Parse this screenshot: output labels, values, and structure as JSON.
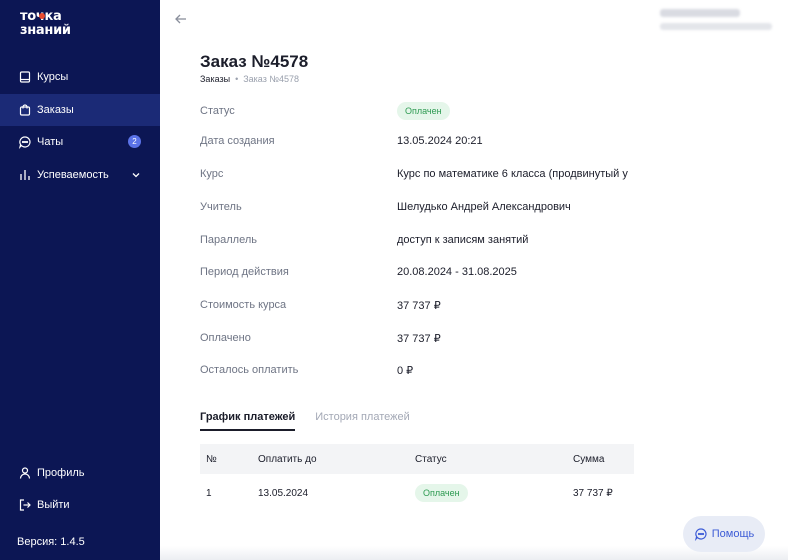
{
  "sidebar": {
    "logo_line1": "точка",
    "logo_line2": "знаний",
    "items": [
      {
        "label": "Курсы"
      },
      {
        "label": "Заказы"
      },
      {
        "label": "Чаты",
        "badge": "2"
      },
      {
        "label": "Успеваемость"
      }
    ],
    "bottom_items": [
      {
        "label": "Профиль"
      },
      {
        "label": "Выйти"
      }
    ],
    "version": "Версия: 1.4.5"
  },
  "header": {
    "title": "Заказ №4578",
    "breadcrumb_root": "Заказы",
    "breadcrumb_sep": "•",
    "breadcrumb_current": "Заказ №4578"
  },
  "details": [
    {
      "label": "Статус",
      "value": "Оплачен"
    },
    {
      "label": "Дата создания",
      "value": "13.05.2024 20:21"
    },
    {
      "label": "Курс",
      "value": "Курс по математике 6 класса (продвинутый у"
    },
    {
      "label": "Учитель",
      "value": "Шелудько Андрей Александрович"
    },
    {
      "label": "Параллель",
      "value": "доступ к записям занятий"
    },
    {
      "label": "Период действия",
      "value": "20.08.2024 - 31.08.2025"
    },
    {
      "label": "Стоимость курса",
      "value": "37 737 ₽"
    },
    {
      "label": "Оплачено",
      "value": "37 737 ₽"
    },
    {
      "label": "Осталось оплатить",
      "value": "0 ₽"
    }
  ],
  "tabs": [
    {
      "label": "График платежей",
      "active": true
    },
    {
      "label": "История платежей",
      "active": false
    }
  ],
  "table": {
    "columns": [
      "№",
      "Оплатить до",
      "Статус",
      "Сумма"
    ],
    "rows": [
      {
        "num": "1",
        "due": "13.05.2024",
        "status": "Оплачен",
        "amount": "37 737 ₽"
      }
    ]
  },
  "help_label": "Помощь",
  "colors": {
    "sidebar_bg": "#0c1654",
    "sidebar_active": "#1b2a76",
    "accent": "#3c5bd6",
    "paid_bg": "#e5f6ea",
    "paid_text": "#2e9b52"
  }
}
